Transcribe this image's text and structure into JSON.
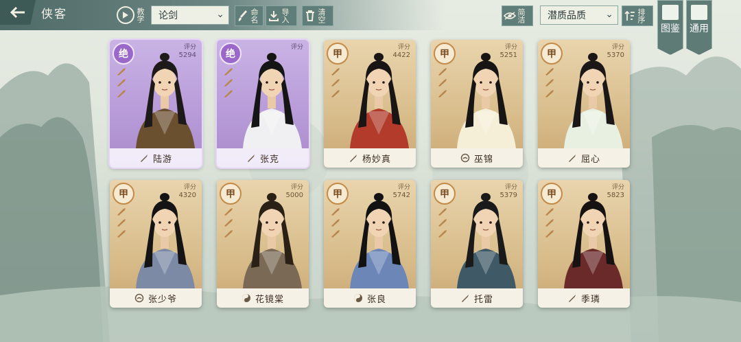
{
  "header": {
    "title": "侠客",
    "tutorial_label": "教学",
    "filter_select": "论剑",
    "rename_label": "命名",
    "import_label": "导入",
    "clear_label": "清空",
    "simple_label": "简洁",
    "sort_select": "潜质品质",
    "sort_label": "排序",
    "codex_label": "图鉴",
    "general_label": "通用"
  },
  "cards": [
    {
      "name": "陆游",
      "grade": "绝",
      "score_label": "评分",
      "score": "5294",
      "tier": "legend",
      "hair": "#1f1a1a",
      "robe": "#6b5030",
      "icon": "sword-icon"
    },
    {
      "name": "张克",
      "grade": "绝",
      "score_label": "评分",
      "score": "",
      "tier": "legend",
      "hair": "#151515",
      "robe": "#f0f0f2",
      "icon": "sword-icon"
    },
    {
      "name": "杨妙真",
      "grade": "甲",
      "score_label": "评分",
      "score": "4422",
      "tier": "gold",
      "hair": "#1a1515",
      "robe": "#b23b2b",
      "icon": "sword-icon"
    },
    {
      "name": "巫锦",
      "grade": "甲",
      "score_label": "评分",
      "score": "5251",
      "tier": "gold",
      "hair": "#171414",
      "robe": "#f4efd6",
      "icon": "circle-icon"
    },
    {
      "name": "屈心",
      "grade": "甲",
      "score_label": "评分",
      "score": "5370",
      "tier": "gold",
      "hair": "#1b1717",
      "robe": "#e8f0e2",
      "icon": "sword-icon"
    },
    {
      "name": "张少爷",
      "grade": "甲",
      "score_label": "评分",
      "score": "4320",
      "tier": "gold",
      "hair": "#141414",
      "robe": "#7c8aa6",
      "icon": "circle-icon"
    },
    {
      "name": "花镜棠",
      "grade": "甲",
      "score_label": "评分",
      "score": "5000",
      "tier": "gold",
      "hair": "#2a2016",
      "robe": "#7a6a55",
      "icon": "yinyang-icon"
    },
    {
      "name": "张良",
      "grade": "甲",
      "score_label": "评分",
      "score": "5742",
      "tier": "gold",
      "hair": "#121212",
      "robe": "#6c86b8",
      "icon": "yinyang-icon"
    },
    {
      "name": "托雷",
      "grade": "甲",
      "score_label": "评分",
      "score": "5379",
      "tier": "gold",
      "hair": "#1a1a1a",
      "robe": "#3f5a66",
      "icon": "sword-icon"
    },
    {
      "name": "季璘",
      "grade": "甲",
      "score_label": "评分",
      "score": "5823",
      "tier": "gold",
      "hair": "#171212",
      "robe": "#6a2a2a",
      "icon": "sword-icon"
    }
  ]
}
